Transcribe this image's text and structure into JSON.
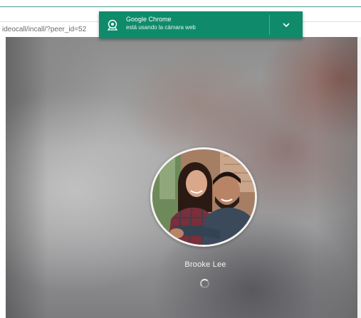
{
  "browser": {
    "url_fragment": "ideocall/incall/?peer_id=52"
  },
  "notification": {
    "title": "Google Chrome",
    "message": "está usando la cámara web",
    "icon": "webcam-icon",
    "expand_icon": "chevron-down-icon",
    "background_color": "#0f8b6c"
  },
  "call": {
    "caller_name": "Brooke Lee",
    "status_icon": "loading-spinner-icon"
  }
}
